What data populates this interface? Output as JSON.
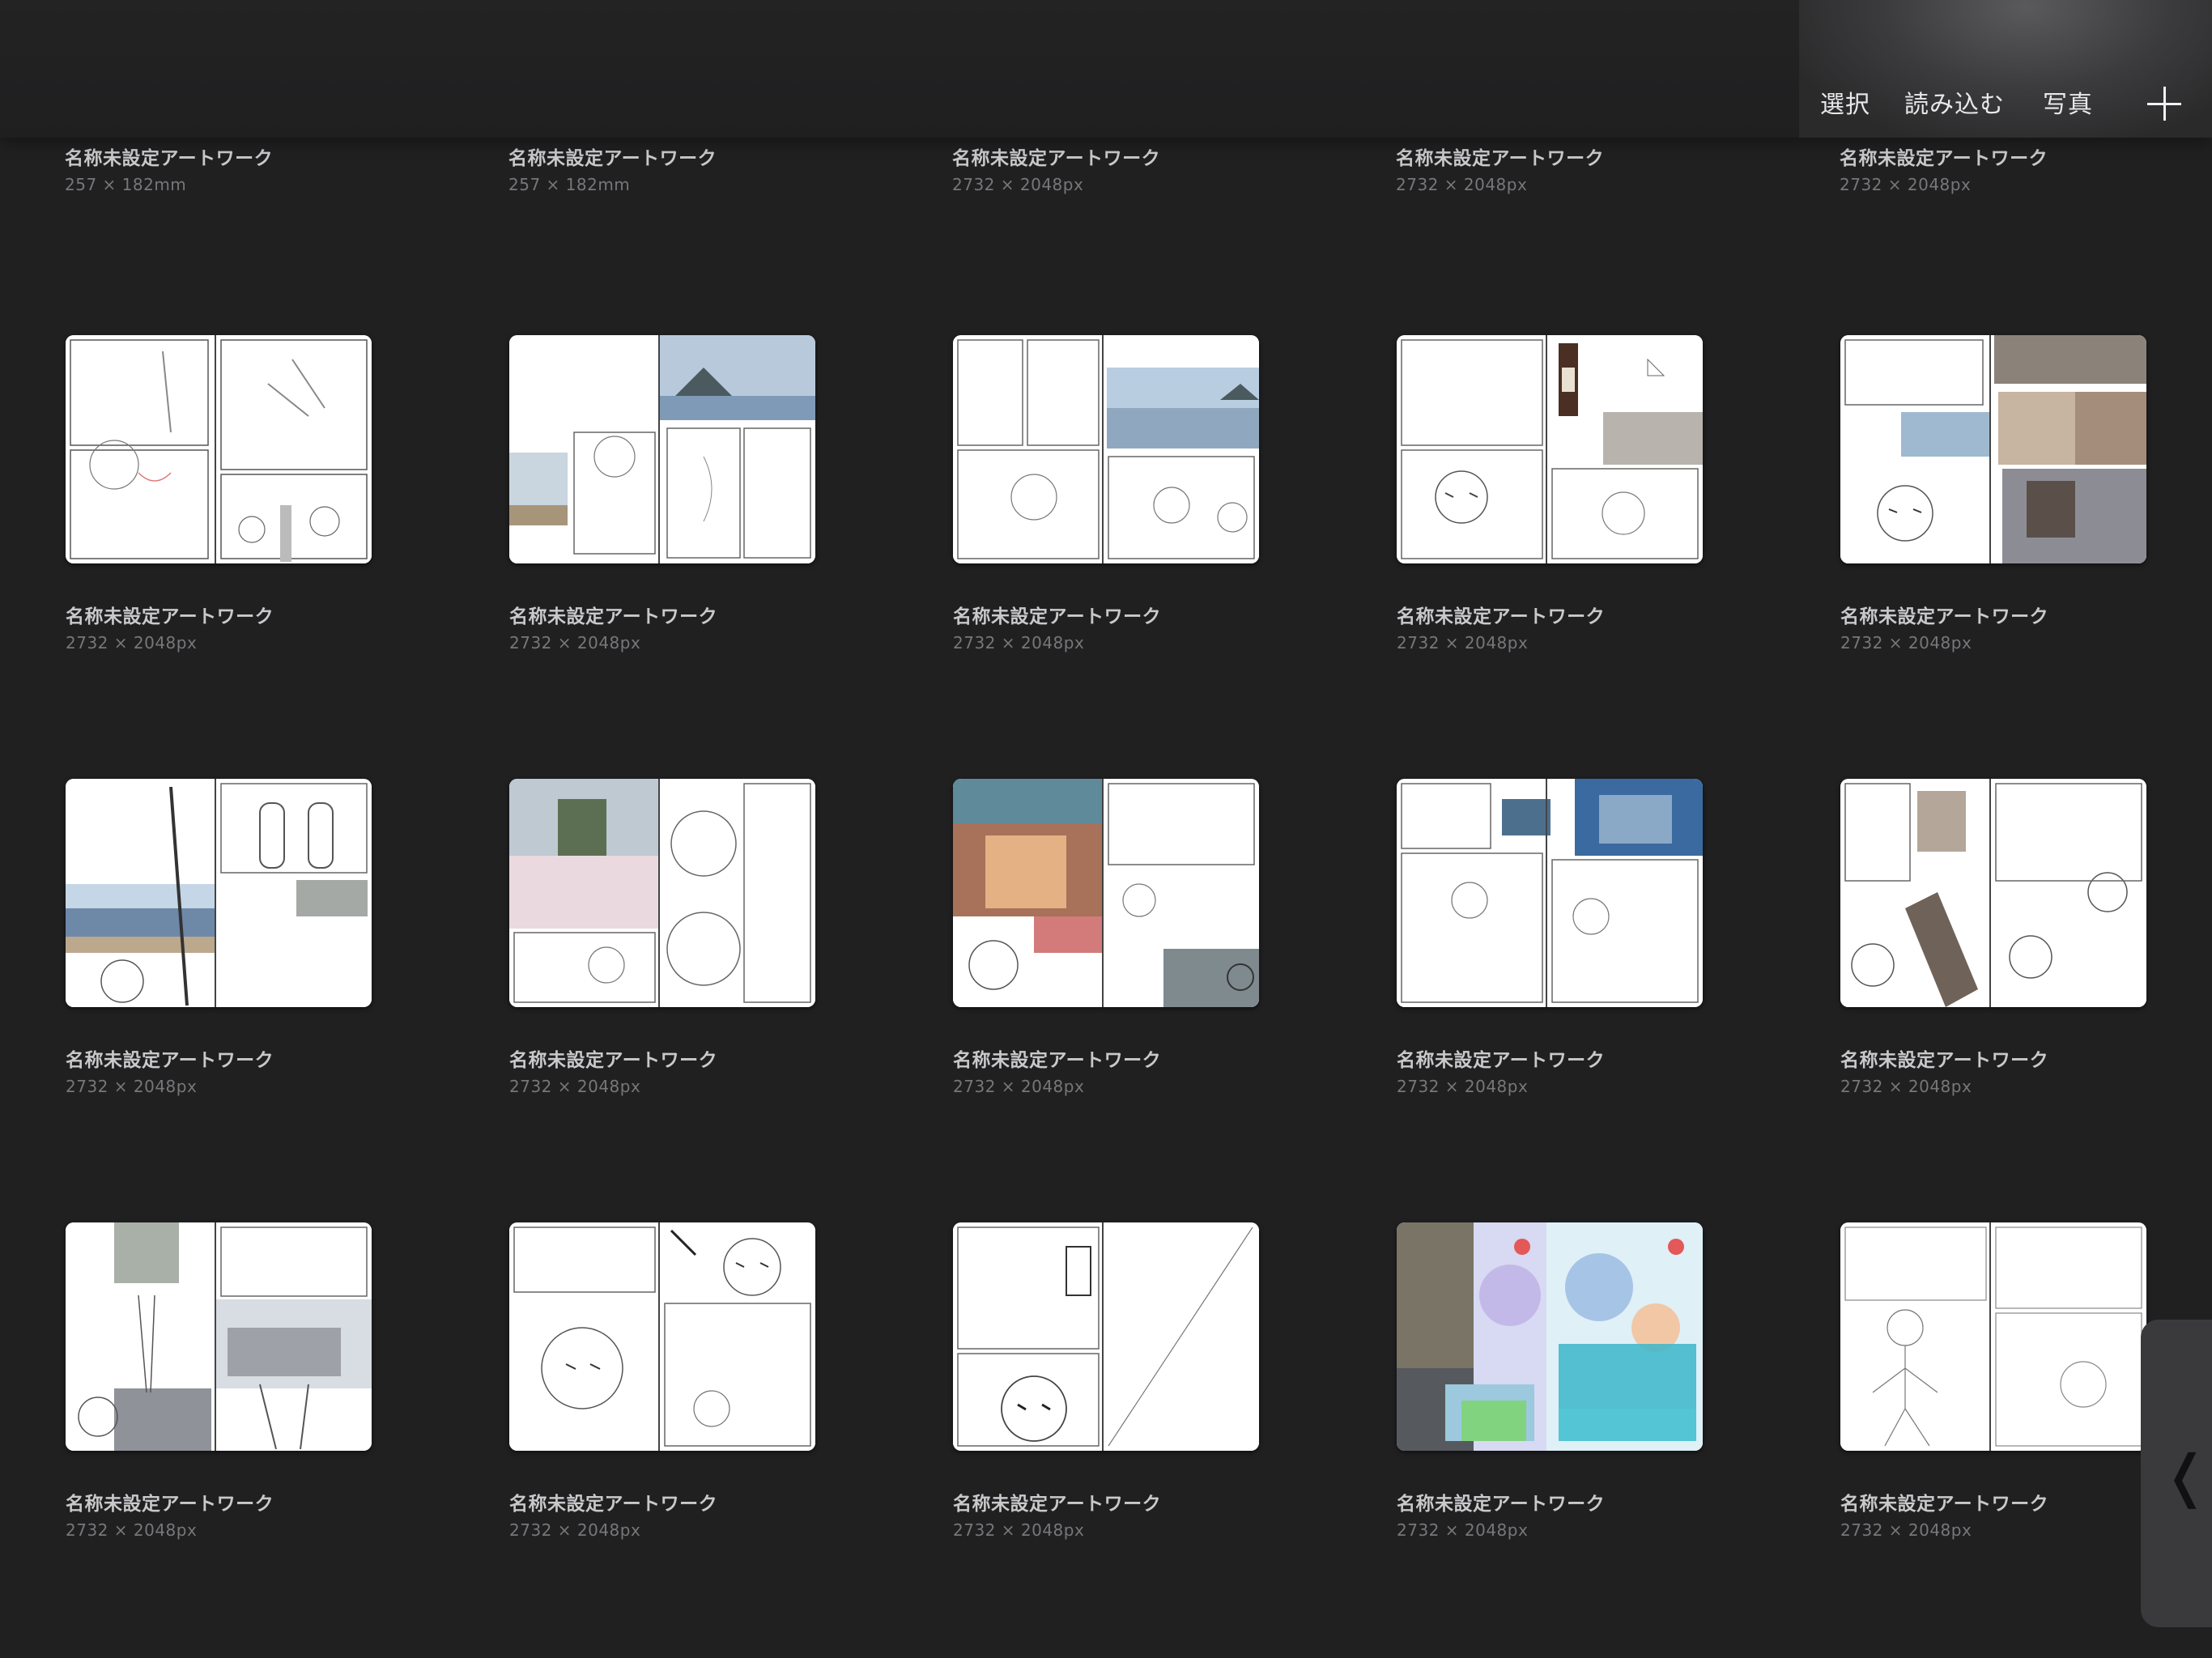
{
  "toolbar": {
    "select_label": "選択",
    "import_label": "読み込む",
    "photo_label": "写真",
    "add_icon": "plus-icon"
  },
  "partial_row": [
    {
      "title": "名称未設定アートワーク",
      "size": "257 × 182mm"
    },
    {
      "title": "名称未設定アートワーク",
      "size": "257 × 182mm"
    },
    {
      "title": "名称未設定アートワーク",
      "size": "2732 × 2048px"
    },
    {
      "title": "名称未設定アートワーク",
      "size": "2732 × 2048px"
    },
    {
      "title": "名称未設定アートワーク",
      "size": "2732 × 2048px"
    }
  ],
  "artworks": [
    {
      "title": "名称未設定アートワーク",
      "size": "2732 × 2048px"
    },
    {
      "title": "名称未設定アートワーク",
      "size": "2732 × 2048px"
    },
    {
      "title": "名称未設定アートワーク",
      "size": "2732 × 2048px"
    },
    {
      "title": "名称未設定アートワーク",
      "size": "2732 × 2048px"
    },
    {
      "title": "名称未設定アートワーク",
      "size": "2732 × 2048px"
    },
    {
      "title": "名称未設定アートワーク",
      "size": "2732 × 2048px"
    },
    {
      "title": "名称未設定アートワーク",
      "size": "2732 × 2048px"
    },
    {
      "title": "名称未設定アートワーク",
      "size": "2732 × 2048px"
    },
    {
      "title": "名称未設定アートワーク",
      "size": "2732 × 2048px"
    },
    {
      "title": "名称未設定アートワーク",
      "size": "2732 × 2048px"
    },
    {
      "title": "名称未設定アートワーク",
      "size": "2732 × 2048px"
    },
    {
      "title": "名称未設定アートワーク",
      "size": "2732 × 2048px"
    },
    {
      "title": "名称未設定アートワーク",
      "size": "2732 × 2048px"
    },
    {
      "title": "名称未設定アートワーク",
      "size": "2732 × 2048px"
    },
    {
      "title": "名称未設定アートワーク",
      "size": "2732 × 2048px"
    }
  ],
  "side_handle": {
    "icon": "chevron-left-icon"
  }
}
